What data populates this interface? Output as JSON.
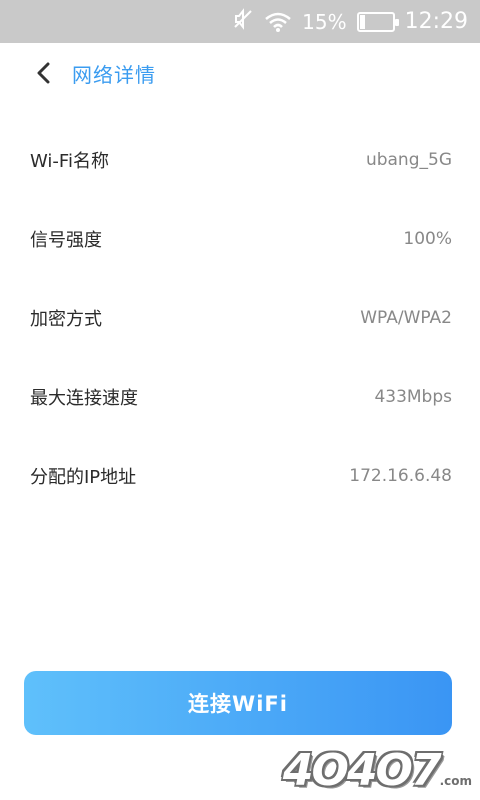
{
  "status_bar": {
    "battery": "15%",
    "time": "12:29",
    "icons": [
      "mute-icon",
      "wifi-icon",
      "battery-icon"
    ]
  },
  "header": {
    "title": "网络详情",
    "back_icon": "chevron-left-icon"
  },
  "details": [
    {
      "label": "Wi-Fi名称",
      "value": "ubang_5G"
    },
    {
      "label": "信号强度",
      "value": "100%"
    },
    {
      "label": "加密方式",
      "value": "WPA/WPA2"
    },
    {
      "label": "最大连接速度",
      "value": "433Mbps"
    },
    {
      "label": "分配的IP地址",
      "value": "172.16.6.48"
    }
  ],
  "connect_button": {
    "label": "连接WiFi"
  },
  "watermark": {
    "text": "4O4O7",
    "suffix": ".com"
  },
  "colors": {
    "accent": "#3b9cf0",
    "button_start": "#5fc0fb",
    "button_end": "#3a95f4",
    "status_bar": "#c9c9c9"
  }
}
